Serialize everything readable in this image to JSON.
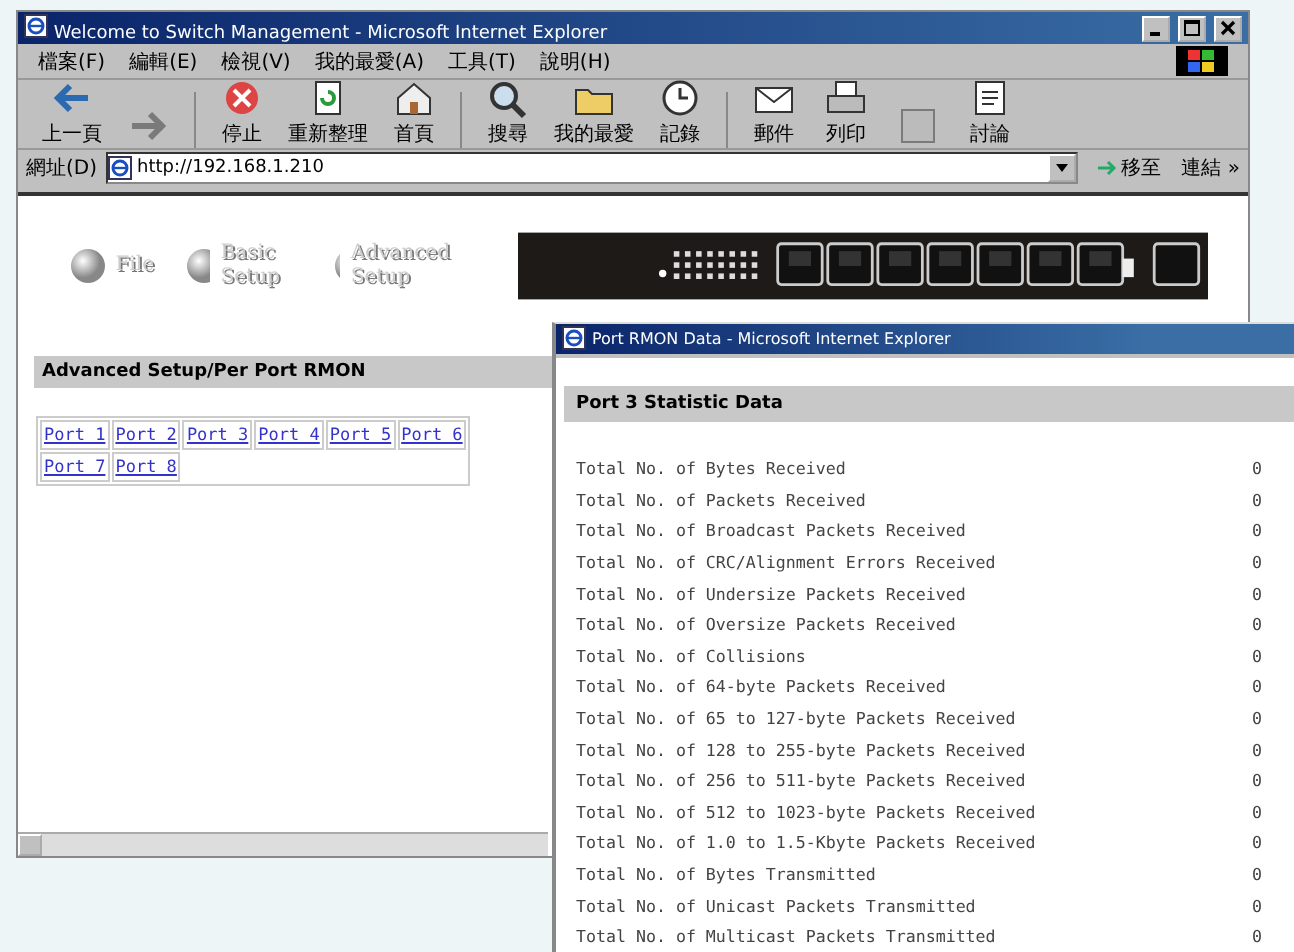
{
  "main_window": {
    "title": "Welcome to Switch Management - Microsoft Internet Explorer",
    "menu": [
      "檔案(F)",
      "編輯(E)",
      "檢視(V)",
      "我的最愛(A)",
      "工具(T)",
      "說明(H)"
    ],
    "toolbar": [
      {
        "kind": "back",
        "label": "上一頁",
        "disabled": false
      },
      {
        "kind": "forward",
        "disabled": true
      },
      {
        "kind": "stop",
        "label": "停止",
        "disabled": false
      },
      {
        "kind": "refresh",
        "label": "重新整理",
        "disabled": false
      },
      {
        "kind": "home",
        "label": "首頁",
        "disabled": false
      },
      {
        "kind": "search",
        "label": "搜尋",
        "disabled": false
      },
      {
        "kind": "favorites",
        "label": "我的最愛",
        "disabled": false
      },
      {
        "kind": "history",
        "label": "記錄",
        "disabled": false
      },
      {
        "kind": "mail",
        "label": "郵件",
        "disabled": false
      },
      {
        "kind": "print",
        "label": "列印",
        "disabled": false
      },
      {
        "kind": "edit",
        "disabled": true
      },
      {
        "kind": "discuss",
        "label": "討論",
        "disabled": false
      }
    ],
    "address": {
      "label": "網址(D)",
      "value": "http://192.168.1.210",
      "go": "移至",
      "links": "連結",
      "more": "»"
    },
    "nav": [
      "File",
      "Basic Setup",
      "Advanced Setup"
    ],
    "section_title": "Advanced Setup/Per Port RMON",
    "ports": [
      "Port 1",
      "Port 2",
      "Port 3",
      "Port 4",
      "Port 5",
      "Port 6",
      "Port 7",
      "Port 8"
    ]
  },
  "popup": {
    "title": "Port RMON Data - Microsoft Internet Explorer",
    "heading": "Port 3 Statistic Data",
    "stats": [
      {
        "label": "Total No. of Bytes Received",
        "value": "0"
      },
      {
        "label": "Total No. of Packets Received",
        "value": "0"
      },
      {
        "label": "Total No. of Broadcast Packets Received",
        "value": "0"
      },
      {
        "label": "Total No. of CRC/Alignment Errors Received",
        "value": "0"
      },
      {
        "label": "Total No. of Undersize Packets Received",
        "value": "0"
      },
      {
        "label": "Total No. of Oversize Packets Received",
        "value": "0"
      },
      {
        "label": "Total No. of Collisions",
        "value": "0"
      },
      {
        "label": "Total No. of 64-byte Packets Received",
        "value": "0"
      },
      {
        "label": "Total No. of 65 to 127-byte Packets Received",
        "value": "0"
      },
      {
        "label": "Total No. of 128 to 255-byte Packets Received",
        "value": "0"
      },
      {
        "label": "Total No. of 256 to 511-byte Packets Received",
        "value": "0"
      },
      {
        "label": "Total No. of 512 to 1023-byte Packets Received",
        "value": "0"
      },
      {
        "label": "Total No. of 1.0 to 1.5-Kbyte Packets Received",
        "value": "0"
      },
      {
        "label": "Total No. of Bytes Transmitted",
        "value": "0"
      },
      {
        "label": "Total No. of Unicast Packets Transmitted",
        "value": "0"
      },
      {
        "label": "Total No. of Multicast Packets Transmitted",
        "value": "0"
      }
    ]
  }
}
